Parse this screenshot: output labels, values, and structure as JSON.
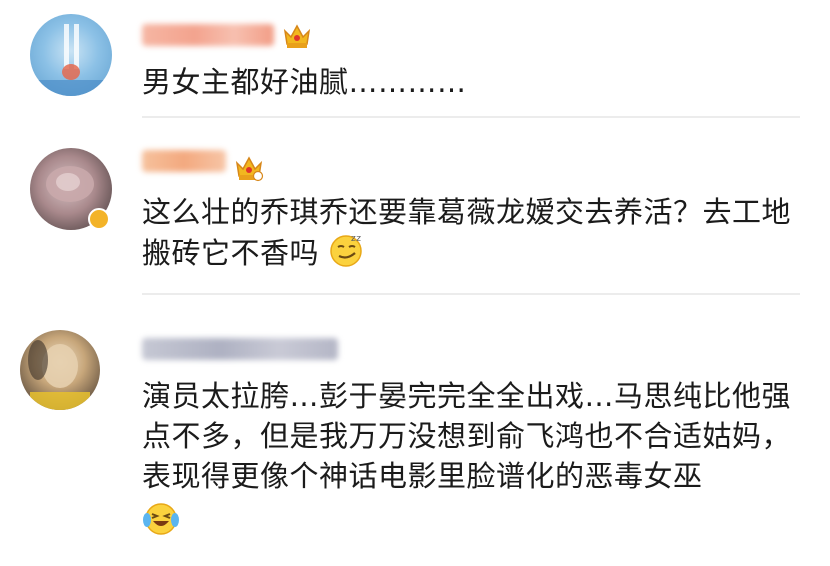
{
  "comments": [
    {
      "text": "男女主都好油腻…………",
      "avatar": "blurred-avatar",
      "badge": "crown-icon",
      "username_color": "#f2a48e"
    },
    {
      "text": "这么壮的乔琪乔还要靠葛薇龙嫒交去养活？去工地搬砖它不香吗",
      "avatar": "blurred-avatar",
      "badge": "crown-icon",
      "emoji": "smirk-emoji",
      "username_color": "#f5b28a"
    },
    {
      "text": "演员太拉胯…彭于晏完完全全出戏…马思纯比他强点不多，但是我万万没想到俞飞鸿也不合适姑妈，表现得更像个神话电影里脸谱化的恶毒女巫",
      "avatar": "blurred-avatar",
      "emoji": "laughing-tears-emoji",
      "username_color": "#b9bccb"
    }
  ]
}
